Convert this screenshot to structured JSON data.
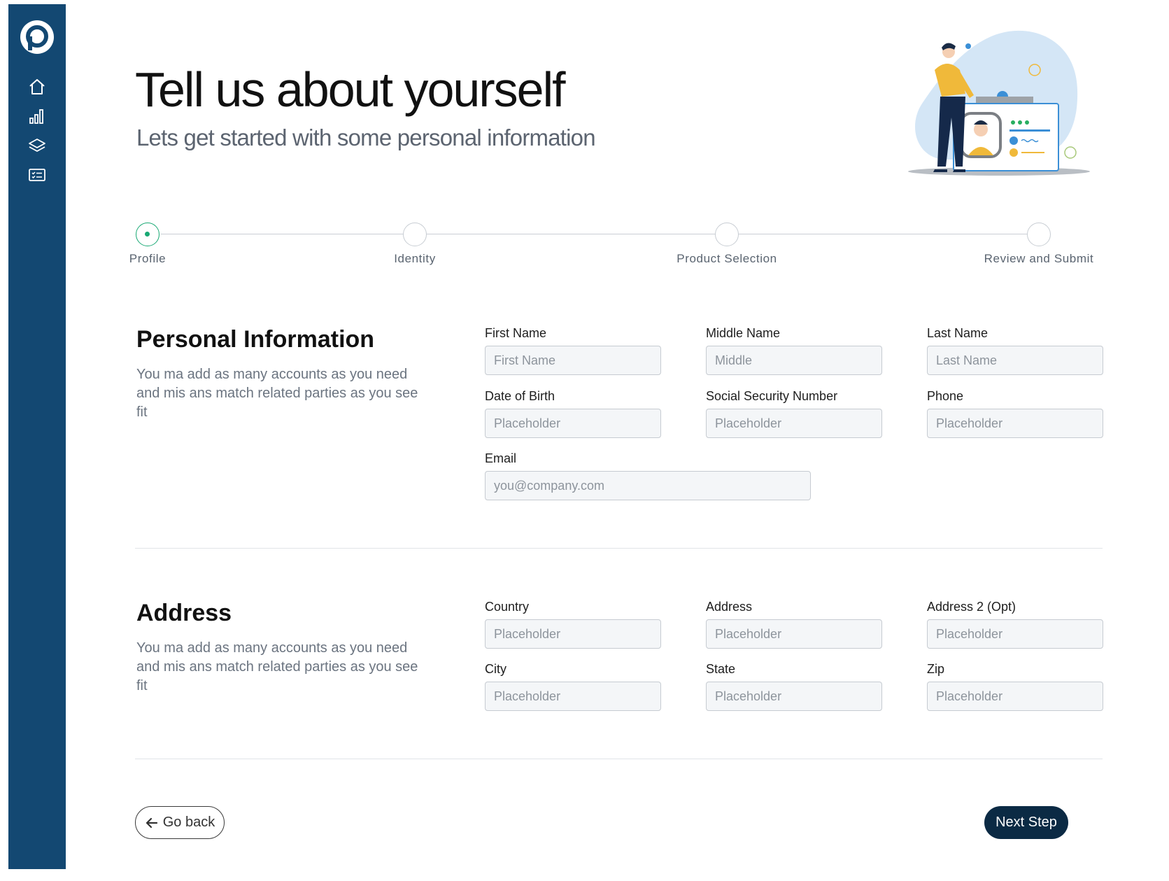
{
  "sidebar": {
    "logo_icon": "p-logo-icon",
    "items": [
      {
        "icon": "home-icon"
      },
      {
        "icon": "bar-chart-icon"
      },
      {
        "icon": "layers-icon"
      },
      {
        "icon": "checklist-card-icon"
      }
    ],
    "background": "#134872"
  },
  "header": {
    "title": "Tell us about yourself",
    "subtitle": "Lets get started with some personal information",
    "illustration": "id-card-person-illustration"
  },
  "stepper": {
    "steps": [
      {
        "label": "Profile",
        "active": true
      },
      {
        "label": "Identity",
        "active": false
      },
      {
        "label": "Product Selection",
        "active": false
      },
      {
        "label": "Review and Submit",
        "active": false
      }
    ],
    "active_color": "#19a974"
  },
  "personal": {
    "title": "Personal Information",
    "description": "You ma add as many accounts as you need and mis ans match related parties as you see fit",
    "fields": {
      "first_name": {
        "label": "First Name",
        "placeholder": "First Name",
        "value": ""
      },
      "middle_name": {
        "label": "Middle Name",
        "placeholder": "Middle",
        "value": ""
      },
      "last_name": {
        "label": "Last Name",
        "placeholder": "Last Name",
        "value": ""
      },
      "dob": {
        "label": "Date of Birth",
        "placeholder": "Placeholder",
        "value": ""
      },
      "ssn": {
        "label": "Social Security Number",
        "placeholder": "Placeholder",
        "value": ""
      },
      "phone": {
        "label": "Phone",
        "placeholder": "Placeholder",
        "value": ""
      },
      "email": {
        "label": "Email",
        "placeholder": "you@company.com",
        "value": ""
      }
    }
  },
  "address": {
    "title": "Address",
    "description": "You ma add as many accounts as you need and mis ans match related parties as you see fit",
    "fields": {
      "country": {
        "label": "Country",
        "placeholder": "Placeholder",
        "value": ""
      },
      "address1": {
        "label": "Address",
        "placeholder": "Placeholder",
        "value": ""
      },
      "address2": {
        "label": "Address 2 (Opt)",
        "placeholder": "Placeholder",
        "value": ""
      },
      "city": {
        "label": "City",
        "placeholder": "Placeholder",
        "value": ""
      },
      "state": {
        "label": "State",
        "placeholder": "Placeholder",
        "value": ""
      },
      "zip": {
        "label": "Zip",
        "placeholder": "Placeholder",
        "value": ""
      }
    }
  },
  "actions": {
    "back_label": "Go back",
    "back_icon": "arrow-left-icon",
    "next_label": "Next Step",
    "next_color": "#0b2a44"
  }
}
